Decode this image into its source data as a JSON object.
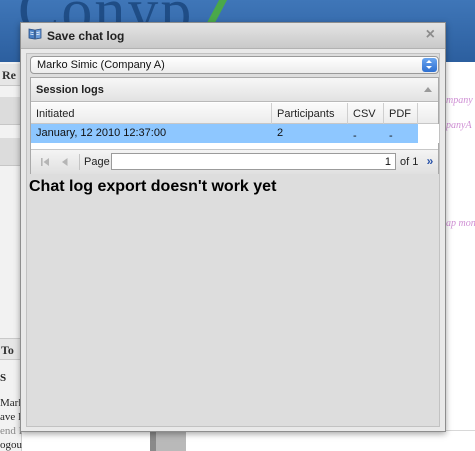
{
  "background": {
    "left_header_1": "Re",
    "left_header_2": "To",
    "left_item_s": "S",
    "left_lines": [
      "Mark",
      "ave I",
      "end File",
      "ogout"
    ],
    "right_lines": [
      "mpany",
      "panyA",
      "ap mon"
    ]
  },
  "dialog": {
    "title": "Save chat log",
    "close_glyph": "×",
    "user_select_value": "Marko Simic (Company A)",
    "panel_title": "Session logs",
    "columns": [
      "Initiated",
      "Participants",
      "CSV",
      "PDF"
    ],
    "rows": [
      {
        "initiated": "January, 12 2010 12:37:00",
        "participants": "2",
        "csv": "-",
        "pdf": "-"
      }
    ],
    "pager": {
      "page_label": "Page",
      "page_value": "1",
      "of_label": "of 1",
      "next_glyph": "»"
    },
    "message": "Chat log export doesn't work yet"
  },
  "colors": {
    "row_selected": "#8ec7ff",
    "select_arrow": "#2e6fd0"
  },
  "icons": [
    "book-icon",
    "close-icon",
    "dropdown-arrows-icon",
    "collapse-icon",
    "first-page-icon",
    "prev-page-icon",
    "next-page-icon"
  ]
}
